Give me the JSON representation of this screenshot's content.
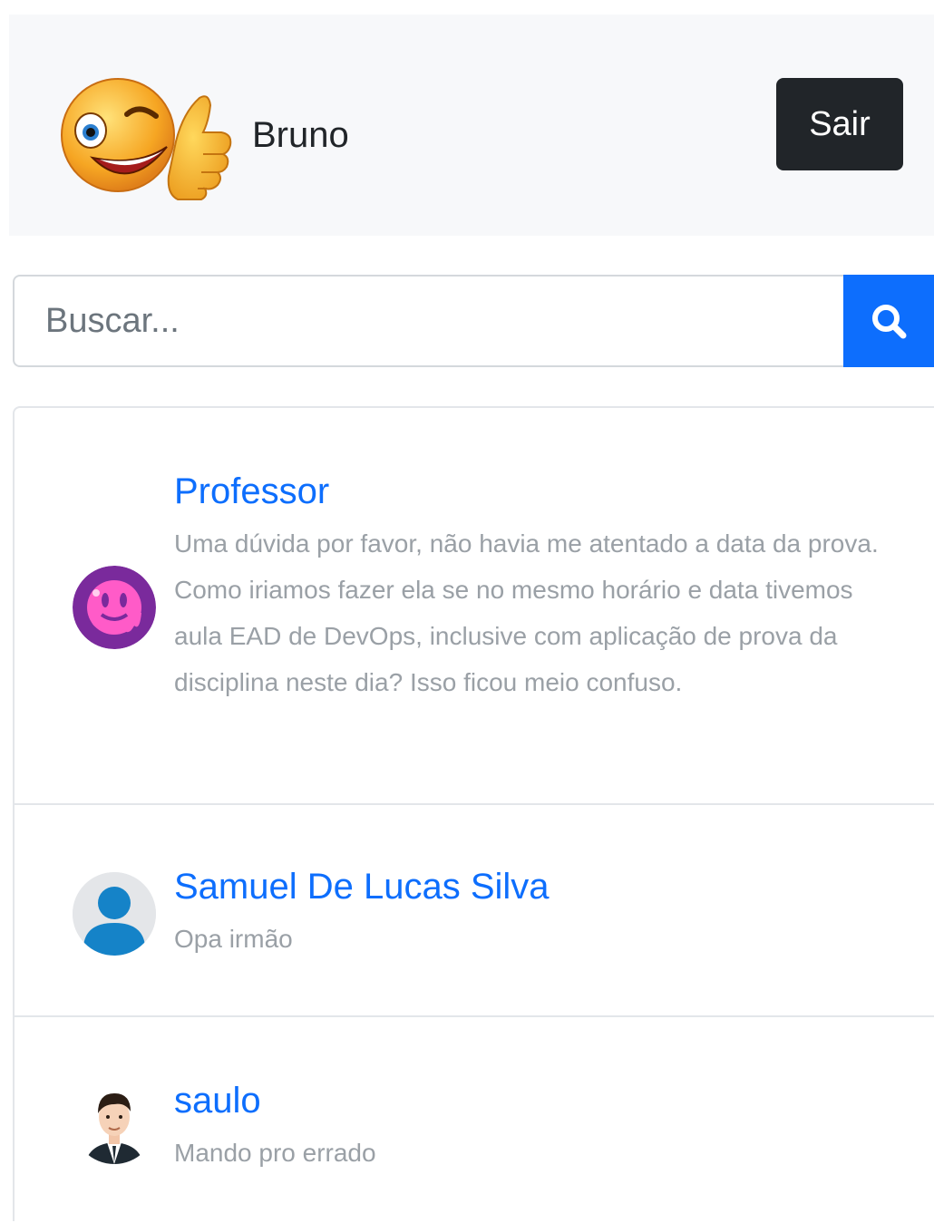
{
  "header": {
    "user_name": "Bruno",
    "logout_label": "Sair",
    "avatar_icon": "winking-thumbs-up-emoji"
  },
  "search": {
    "placeholder": "Buscar...",
    "button_icon": "search-icon"
  },
  "colors": {
    "accent": "#0d6efd",
    "dark_button": "#212529",
    "header_bg": "#f7f8fa",
    "muted_text": "#9aa0a6"
  },
  "chats": [
    {
      "name": "Professor",
      "avatar_icon": "melting-smiley-avatar",
      "preview": "Uma dúvida por favor, não havia me atentado a data da prova. Como iriamos fazer ela se no mesmo horário e data tivemos aula EAD de DevOps, inclusive com aplicação de prova da disciplina neste dia? Isso ficou meio confuso."
    },
    {
      "name": "Samuel De Lucas Silva",
      "avatar_icon": "default-user-avatar",
      "preview": "Opa irmão"
    },
    {
      "name": "saulo",
      "avatar_icon": "man-in-suit-avatar",
      "preview": "Mando pro errado"
    }
  ]
}
